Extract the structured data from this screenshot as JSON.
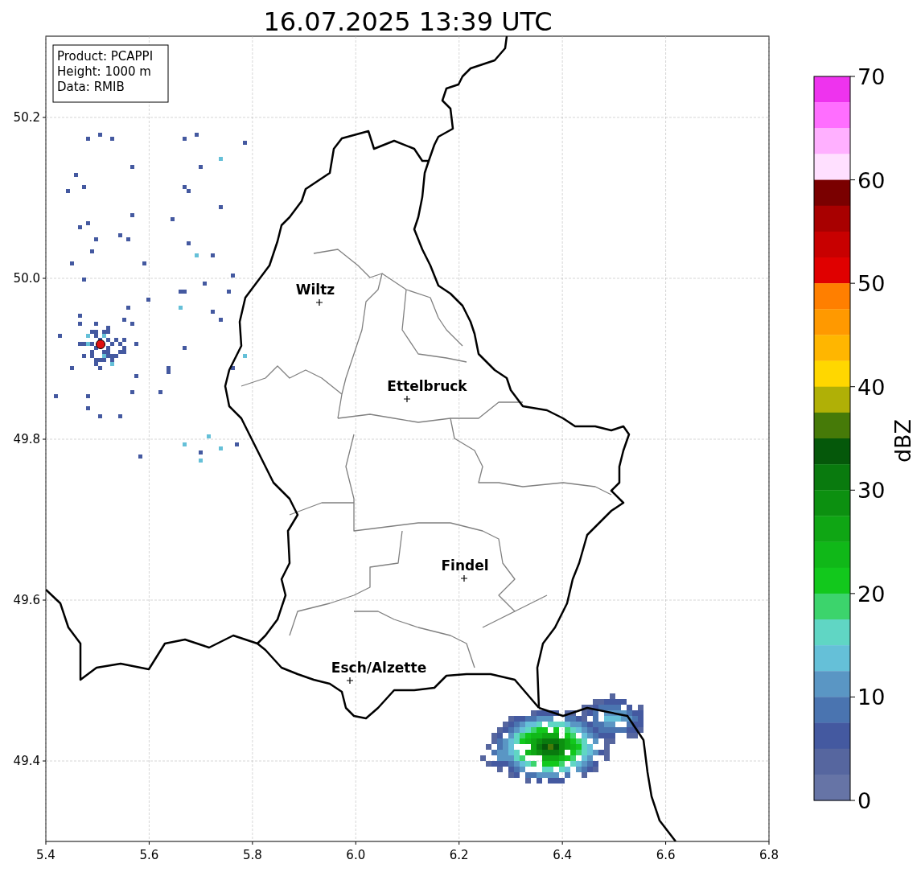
{
  "title": "16.07.2025 13:39 UTC",
  "info_box": [
    "Product: PCAPPI",
    "Height: 1000 m",
    "Data: RMIB"
  ],
  "x_ticks": [
    "5.4",
    "5.6",
    "5.8",
    "6.0",
    "6.2",
    "6.4",
    "6.6",
    "6.8"
  ],
  "y_ticks": [
    "50.2",
    "50.0",
    "49.8",
    "49.6",
    "49.4"
  ],
  "cities": [
    {
      "name": "Wiltz"
    },
    {
      "name": "Ettelbruck"
    },
    {
      "name": "Findel"
    },
    {
      "name": "Esch/Alzette"
    }
  ],
  "colorbar": {
    "label": "dBZ",
    "ticks": [
      "70",
      "60",
      "50",
      "40",
      "30",
      "20",
      "10",
      "0"
    ],
    "bands": [
      {
        "color": "#ee33ee"
      },
      {
        "color": "#ff6eff"
      },
      {
        "color": "#ffb0ff"
      },
      {
        "color": "#ffe0ff"
      },
      {
        "color": "#7a0000"
      },
      {
        "color": "#a80000"
      },
      {
        "color": "#c80000"
      },
      {
        "color": "#e00000"
      },
      {
        "color": "#ff7f00"
      },
      {
        "color": "#ff9900"
      },
      {
        "color": "#ffb600"
      },
      {
        "color": "#ffd700"
      },
      {
        "color": "#b0b006"
      },
      {
        "color": "#467a08"
      },
      {
        "color": "#05580a"
      },
      {
        "color": "#097a0e"
      },
      {
        "color": "#0c9010"
      },
      {
        "color": "#0fa614"
      },
      {
        "color": "#10b818"
      },
      {
        "color": "#12c81c"
      },
      {
        "color": "#3cd46c"
      },
      {
        "color": "#60d6c4"
      },
      {
        "color": "#65c0d8"
      },
      {
        "color": "#5a96c4"
      },
      {
        "color": "#4a74b0"
      },
      {
        "color": "#4459a0"
      },
      {
        "color": "#56669f"
      },
      {
        "color": "#6674a6"
      }
    ]
  }
}
